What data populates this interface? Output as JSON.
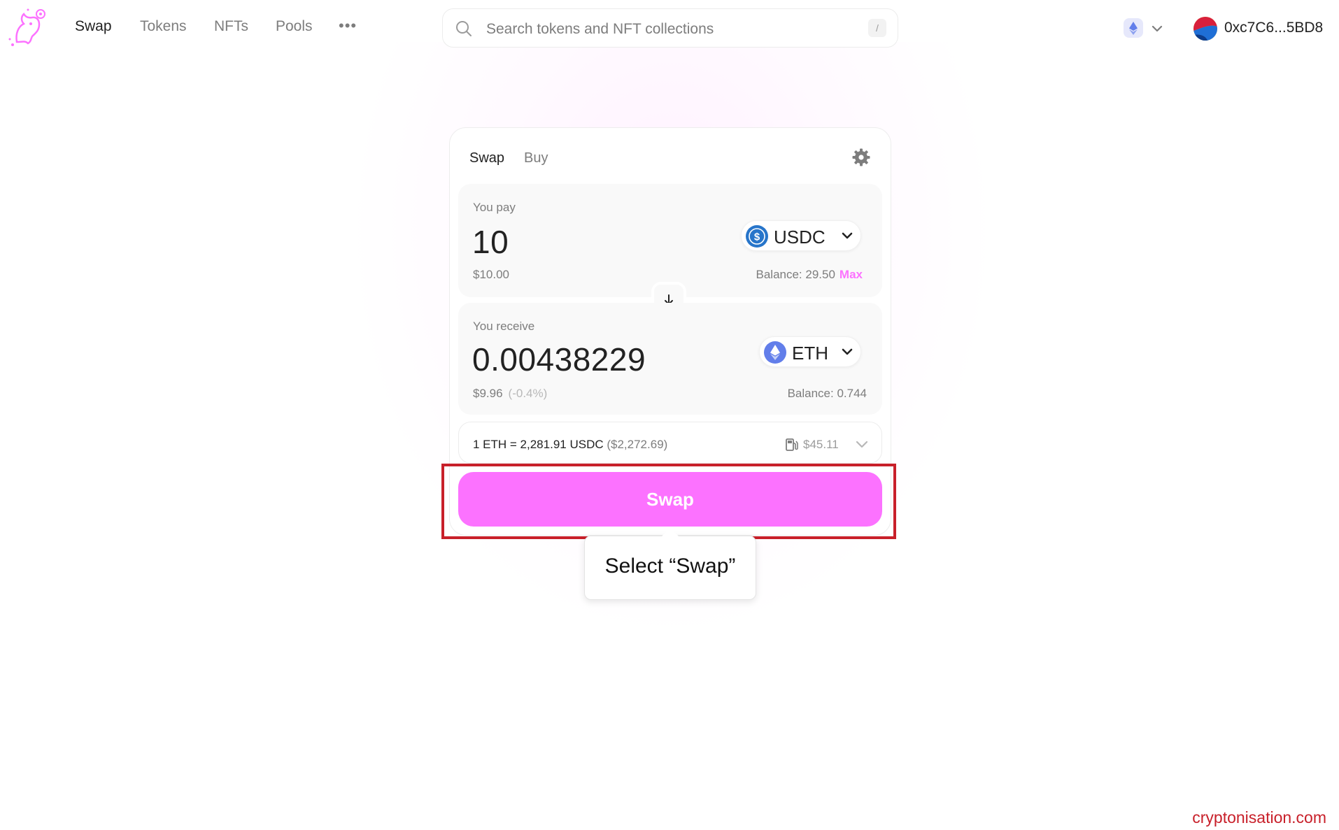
{
  "nav": {
    "links": [
      {
        "label": "Swap",
        "active": true
      },
      {
        "label": "Tokens",
        "active": false
      },
      {
        "label": "NFTs",
        "active": false
      },
      {
        "label": "Pools",
        "active": false
      }
    ],
    "more_label": "•••"
  },
  "search": {
    "placeholder": "Search tokens and NFT collections",
    "shortcut": "/"
  },
  "account": {
    "address": "0xc7C6...5BD8",
    "network_icon": "ethereum-icon"
  },
  "swap_card": {
    "tabs": [
      {
        "label": "Swap",
        "active": true
      },
      {
        "label": "Buy",
        "active": false
      }
    ],
    "pay": {
      "label": "You pay",
      "amount": "10",
      "usd": "$10.00",
      "token": "USDC",
      "balance": "Balance: 29.50",
      "max_label": "Max"
    },
    "receive": {
      "label": "You receive",
      "amount": "0.00438229",
      "usd": "$9.96",
      "delta": "(-0.4%)",
      "token": "ETH",
      "balance": "Balance: 0.744"
    },
    "rate": {
      "text": "1 ETH = 2,281.91 USDC",
      "fiat": "($2,272.69)",
      "gas": "$45.11"
    },
    "swap_button": "Swap"
  },
  "tooltip": {
    "text": "Select “Swap”"
  },
  "watermark": "cryptonisation.com",
  "colors": {
    "accent": "#fc72ff",
    "highlight": "#c8202a",
    "usdc": "#2775ca",
    "eth": "#627eea"
  }
}
